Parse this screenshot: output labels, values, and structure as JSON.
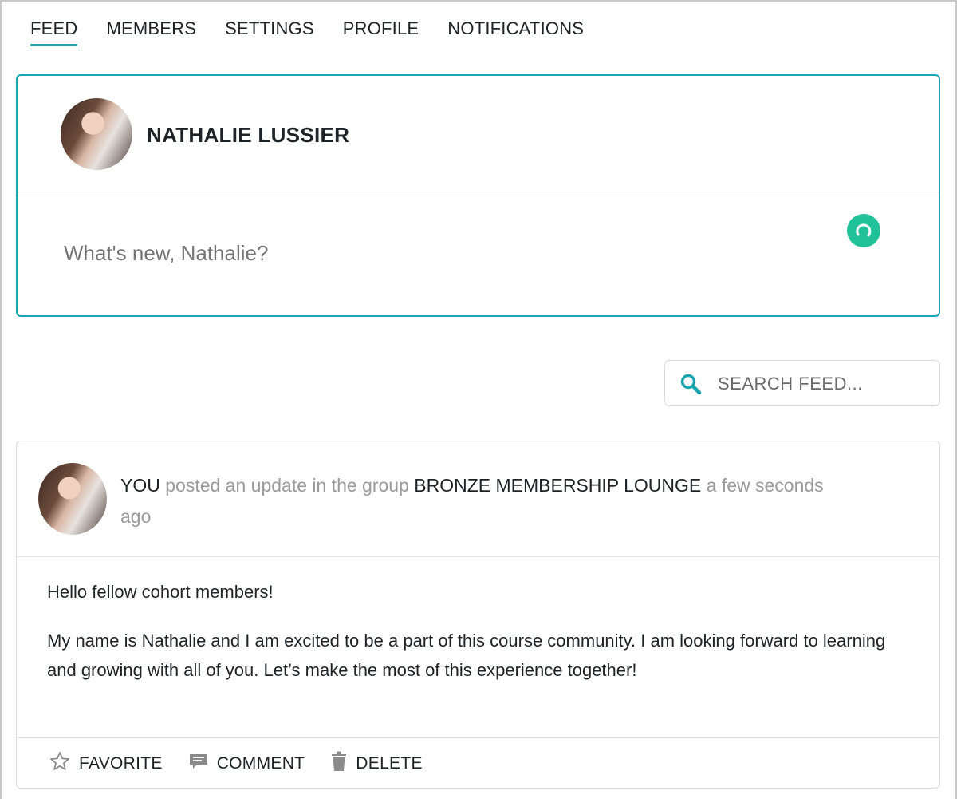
{
  "tabs": [
    {
      "label": "FEED",
      "active": true
    },
    {
      "label": "MEMBERS"
    },
    {
      "label": "SETTINGS"
    },
    {
      "label": "PROFILE"
    },
    {
      "label": "NOTIFICATIONS"
    }
  ],
  "composer": {
    "user_name": "NATHALIE LUSSIER",
    "placeholder": "What's new, Nathalie?"
  },
  "search": {
    "placeholder": "SEARCH FEED..."
  },
  "post": {
    "author": "YOU",
    "action_text": "posted an update in the group",
    "group": "BRONZE MEMBERSHIP LOUNGE",
    "time": "a few seconds ago",
    "paragraphs": [
      "Hello fellow cohort members!",
      "My name is Nathalie and I am excited to be a part of this course community. I am looking forward to learning and growing with all of you. Let’s make the most of this experience together!"
    ],
    "actions": {
      "favorite": "FAVORITE",
      "comment": "COMMENT",
      "delete": "DELETE"
    }
  },
  "icons": {
    "search": "search-icon",
    "favorite": "star-icon",
    "comment": "comment-icon",
    "delete": "trash-icon",
    "loading": "loading-spinner-icon"
  },
  "colors": {
    "accent": "#1aa6b0",
    "loader": "#21c29a"
  }
}
